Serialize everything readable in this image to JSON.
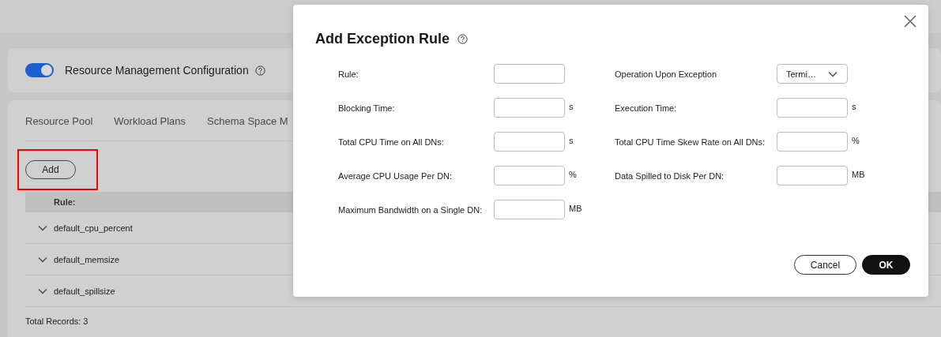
{
  "page": {
    "config": {
      "on": true,
      "label": "Resource Management Configuration"
    },
    "tabs": [
      {
        "label": "Resource Pool"
      },
      {
        "label": "Workload Plans"
      },
      {
        "label": "Schema Space M"
      }
    ],
    "add_button": "Add",
    "table": {
      "columns": [
        "Rule:"
      ],
      "rows": [
        {
          "name": "default_cpu_percent",
          "expanded": false
        },
        {
          "name": "default_memsize",
          "expanded": false
        },
        {
          "name": "default_spillsize",
          "expanded": false
        }
      ]
    },
    "total_records": "Total Records: 3"
  },
  "dialog": {
    "title": "Add Exception Rule",
    "left_fields": [
      {
        "kind": "input",
        "label": "Rule:"
      },
      {
        "kind": "input",
        "label": "Blocking Time:",
        "unit": "s"
      },
      {
        "kind": "input",
        "label": "Total CPU Time on All DNs:",
        "unit": "s"
      },
      {
        "kind": "input",
        "label": "Average CPU Usage Per DN:",
        "unit": "%"
      },
      {
        "kind": "input",
        "label": "Maximum Bandwidth on a Single DN:",
        "unit": "MB"
      }
    ],
    "right_fields": [
      {
        "kind": "select",
        "label": "Operation Upon Exception",
        "value": "Termi…"
      },
      {
        "kind": "input",
        "label": "Execution Time:",
        "unit": "s"
      },
      {
        "kind": "input",
        "label": "Total CPU Time Skew Rate on All DNs:",
        "unit": "%"
      },
      {
        "kind": "input",
        "label": "Data Spilled to Disk Per DN:",
        "unit": "MB"
      }
    ],
    "buttons": [
      {
        "kind": "secondary",
        "label": "Cancel"
      },
      {
        "kind": "primary",
        "label": "OK"
      }
    ]
  }
}
